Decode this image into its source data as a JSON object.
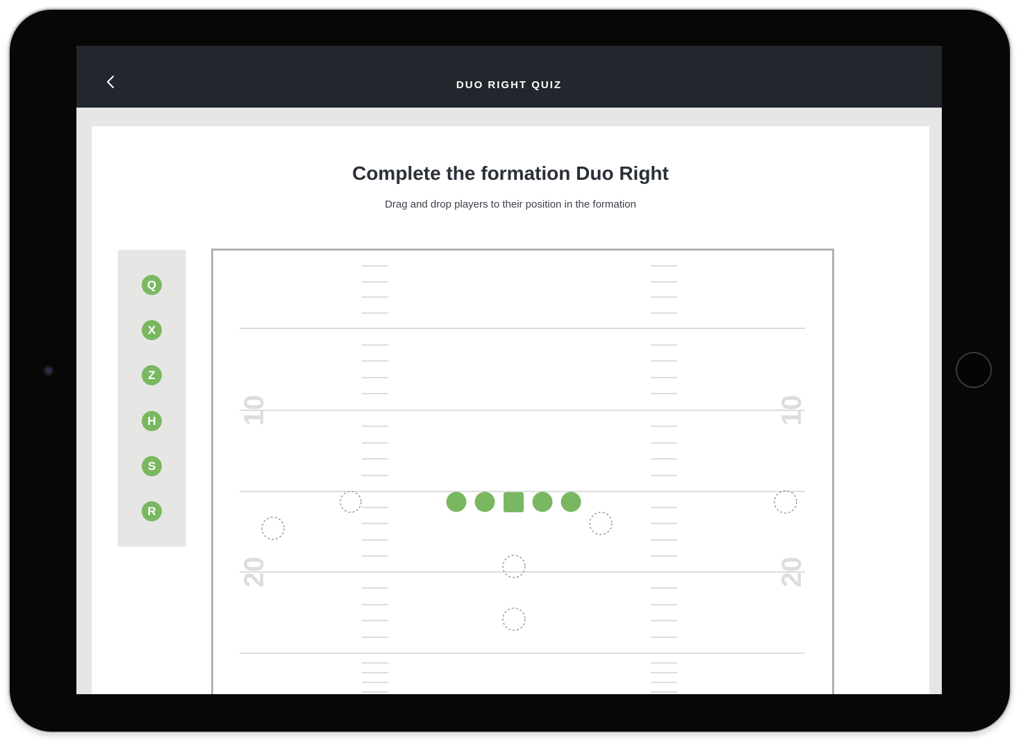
{
  "nav": {
    "title": "DUO RIGHT QUIZ",
    "back_icon": "chevron-left-icon"
  },
  "quiz": {
    "heading": "Complete the formation Duo Right",
    "instructions": "Drag and drop players to their position in the formation"
  },
  "palette": {
    "players": [
      "Q",
      "X",
      "Z",
      "H",
      "S",
      "R"
    ],
    "color": "#7ab761"
  },
  "field": {
    "yard_numbers": [
      "10",
      "20"
    ],
    "linemen_color": "#7ab761",
    "linemen": [
      "circle",
      "circle",
      "square",
      "circle",
      "circle"
    ],
    "drop_zone_count": 7
  }
}
